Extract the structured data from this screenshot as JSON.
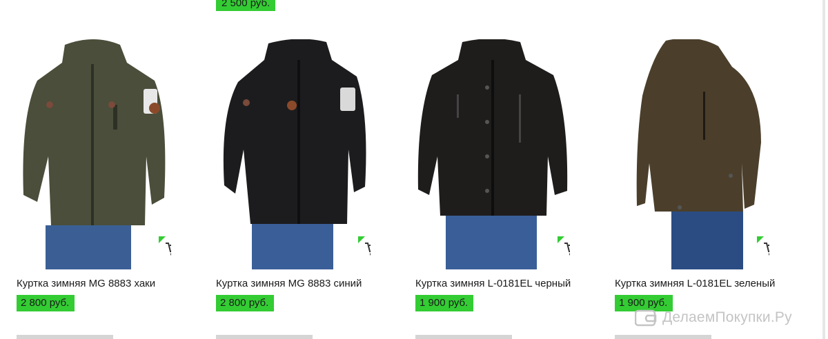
{
  "previous_row": {
    "price": "2 500 руб."
  },
  "products": [
    {
      "title": "Куртка зимняя MG 8883 хаки",
      "price": "2 800 руб.",
      "color": "#4a4e3a"
    },
    {
      "title": "Куртка зимняя MG 8883 синий",
      "price": "2 800 руб.",
      "color": "#1c1c1e"
    },
    {
      "title": "Куртка зимняя L-0181EL черный",
      "price": "1 900 руб.",
      "color": "#1f1d1c"
    },
    {
      "title": "Куртка зимняя L-0181EL зеленый",
      "price": "1 900 руб.",
      "color": "#4b3f2c"
    }
  ],
  "cart_icon": "cart-icon",
  "accent_color": "#33cc33",
  "watermark": {
    "text": "ДелаемПокупки.Ру",
    "icon": "wallet-icon"
  }
}
